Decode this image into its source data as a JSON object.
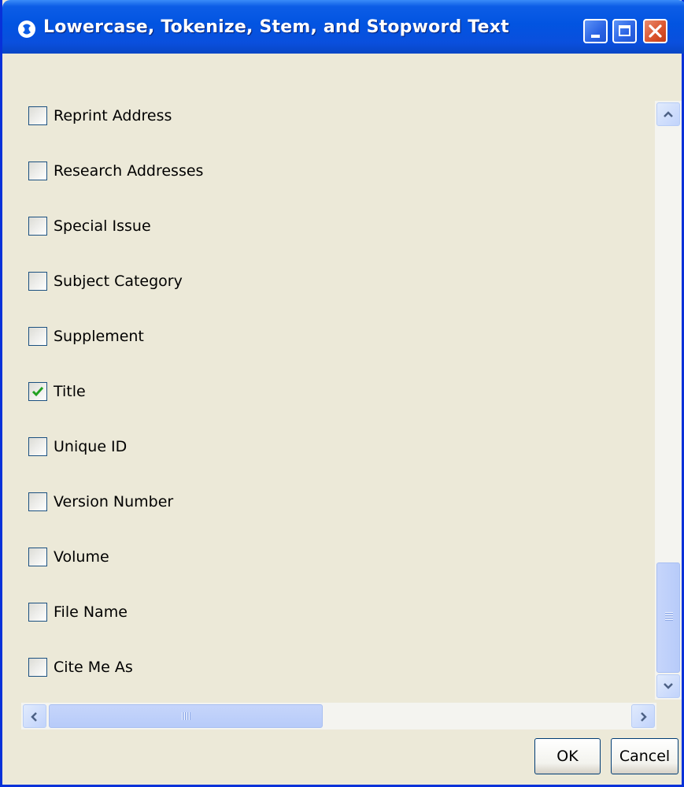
{
  "window": {
    "title": "Lowercase, Tokenize, Stem, and Stopword Text",
    "controls": [
      "minimize",
      "maximize",
      "close"
    ],
    "title_bar_color": "#0254e1"
  },
  "fields": [
    {
      "label": "Reprint Address",
      "checked": false
    },
    {
      "label": "Research Addresses",
      "checked": false
    },
    {
      "label": "Special Issue",
      "checked": false
    },
    {
      "label": "Subject Category",
      "checked": false
    },
    {
      "label": "Supplement",
      "checked": false
    },
    {
      "label": "Title",
      "checked": true
    },
    {
      "label": "Unique ID",
      "checked": false
    },
    {
      "label": "Version Number",
      "checked": false
    },
    {
      "label": "Volume",
      "checked": false
    },
    {
      "label": "File Name",
      "checked": false
    },
    {
      "label": "Cite Me As",
      "checked": false
    }
  ],
  "scroll": {
    "vertical_position": "bottom",
    "horizontal_position": "left"
  },
  "buttons": {
    "ok_label": "OK",
    "cancel_label": "Cancel"
  },
  "colors": {
    "check_mark": "#21a121",
    "dialog_background": "#ece9d8"
  }
}
